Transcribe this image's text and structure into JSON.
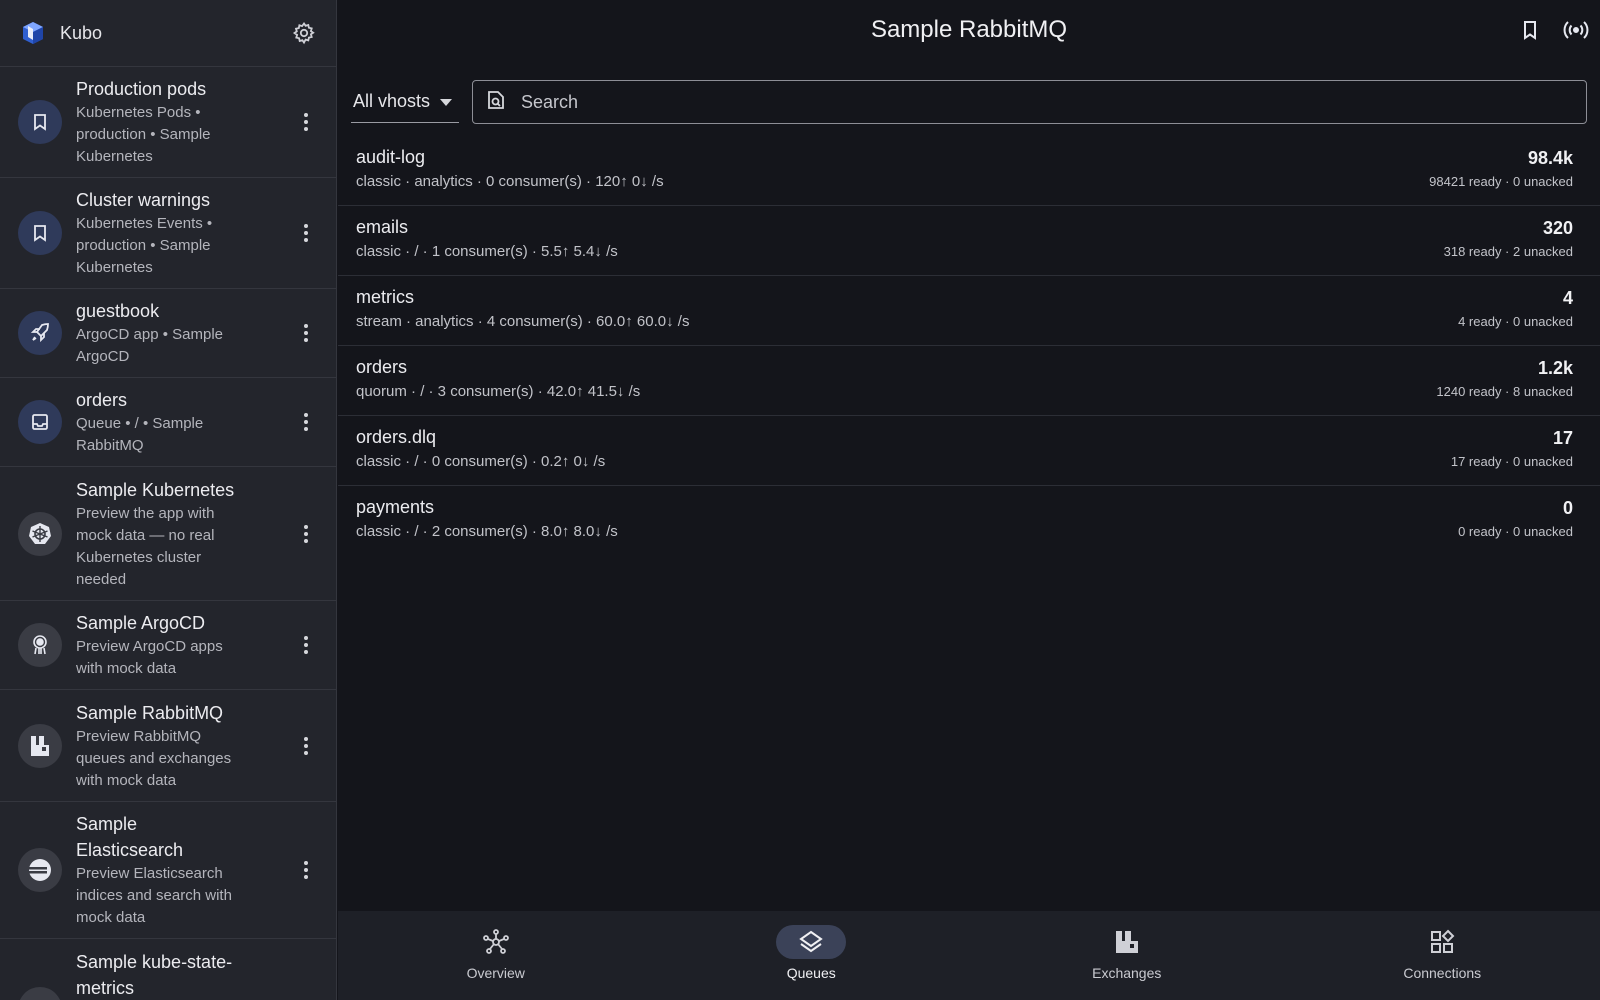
{
  "app": {
    "name": "Kubo",
    "logo_icon": "kubo-cube-icon"
  },
  "sidebar": {
    "items": [
      {
        "title": "Production pods",
        "subtitle_lines": [
          "Kubernetes Pods •",
          "production • Sample",
          "Kubernetes"
        ],
        "icon": "bookmark-icon"
      },
      {
        "title": "Cluster warnings",
        "subtitle_lines": [
          "Kubernetes Events •",
          "production • Sample",
          "Kubernetes"
        ],
        "icon": "bookmark-icon"
      },
      {
        "title": "guestbook",
        "subtitle_lines": [
          "ArgoCD app • Sample",
          "ArgoCD"
        ],
        "icon": "rocket-icon"
      },
      {
        "title": "orders",
        "subtitle_lines": [
          "Queue • / • Sample",
          "RabbitMQ"
        ],
        "icon": "inbox-icon"
      },
      {
        "title": "Sample Kubernetes",
        "subtitle_lines": [
          "Preview the app with",
          "mock data — no real",
          "Kubernetes cluster",
          "needed"
        ],
        "icon": "kubernetes-helm-icon"
      },
      {
        "title": "Sample ArgoCD",
        "subtitle_lines": [
          "Preview ArgoCD apps",
          "with mock data"
        ],
        "icon": "argocd-octopus-icon"
      },
      {
        "title": "Sample RabbitMQ",
        "subtitle_lines": [
          "Preview RabbitMQ",
          "queues and exchanges",
          "with mock data"
        ],
        "icon": "rabbitmq-icon"
      },
      {
        "title_lines": [
          "Sample",
          "Elasticsearch"
        ],
        "subtitle_lines": [
          "Preview Elasticsearch",
          "indices and search with",
          "mock data"
        ],
        "icon": "elasticsearch-icon"
      },
      {
        "title_lines": [
          "Sample kube-state-",
          "metrics"
        ],
        "subtitle_lines": [],
        "icon": "metrics-icon"
      }
    ]
  },
  "header": {
    "title": "Sample RabbitMQ",
    "actions": [
      "bookmark-icon",
      "broadcast-icon"
    ]
  },
  "filters": {
    "vhost": "All vhosts",
    "search_placeholder": "Search"
  },
  "queues": [
    {
      "name": "audit-log",
      "meta": "classic · analytics · 0 consumer(s) · 120↑ 0↓ /s",
      "count": "98.4k",
      "state": "98421 ready · 0 unacked"
    },
    {
      "name": "emails",
      "meta": "classic · / · 1 consumer(s) · 5.5↑ 5.4↓ /s",
      "count": "320",
      "state": "318 ready · 2 unacked"
    },
    {
      "name": "metrics",
      "meta": "stream · analytics · 4 consumer(s) · 60.0↑ 60.0↓ /s",
      "count": "4",
      "state": "4 ready · 0 unacked"
    },
    {
      "name": "orders",
      "meta": "quorum · / · 3 consumer(s) · 42.0↑ 41.5↓ /s",
      "count": "1.2k",
      "state": "1240 ready · 8 unacked"
    },
    {
      "name": "orders.dlq",
      "meta": "classic · / · 0 consumer(s) · 0.2↑ 0↓ /s",
      "count": "17",
      "state": "17 ready · 0 unacked"
    },
    {
      "name": "payments",
      "meta": "classic · / · 2 consumer(s) · 8.0↑ 8.0↓ /s",
      "count": "0",
      "state": "0 ready · 0 unacked"
    }
  ],
  "bottom_nav": [
    {
      "label": "Overview",
      "icon": "hub-icon",
      "active": false
    },
    {
      "label": "Queues",
      "icon": "layers-icon",
      "active": true
    },
    {
      "label": "Exchanges",
      "icon": "factory-icon",
      "active": false
    },
    {
      "label": "Connections",
      "icon": "widgets-icon",
      "active": false
    }
  ],
  "colors": {
    "background": "#14151b",
    "sidebar": "#23252c",
    "avatar": "#2f3a5a",
    "active_nav": "#3b4258"
  }
}
